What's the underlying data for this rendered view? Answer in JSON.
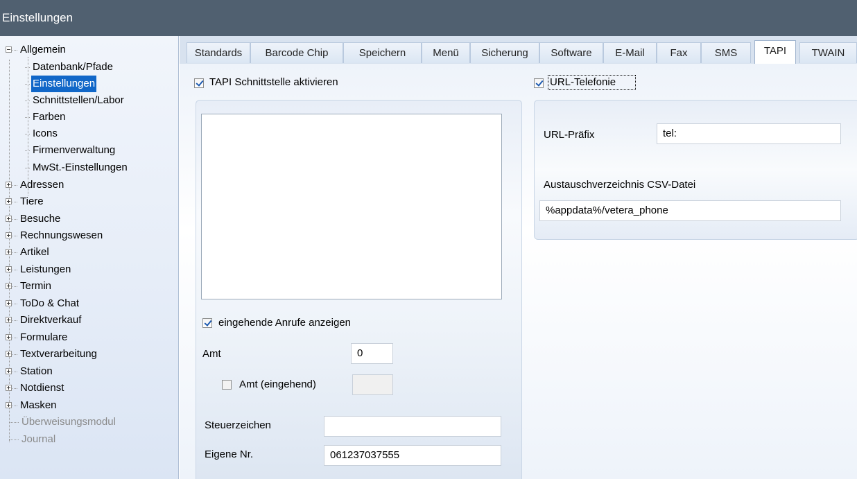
{
  "window": {
    "title": "Einstellungen"
  },
  "tree": {
    "group1_label": "Allgemein",
    "children": [
      "Datenbank/Pfade",
      "Einstellungen",
      "Schnittstellen/Labor",
      "Farben",
      "Icons",
      "Firmenverwaltung",
      "MwSt.-Einstellungen"
    ],
    "groups": [
      "Adressen",
      "Tiere",
      "Besuche",
      "Rechnungswesen",
      "Artikel",
      "Leistungen",
      "Termin",
      "ToDo & Chat",
      "Direktverkauf",
      "Formulare",
      "Textverarbeitung",
      "Station",
      "Notdienst",
      "Masken"
    ],
    "disabled": [
      "Überweisungsmodul",
      "Journal"
    ]
  },
  "tabs": [
    "Standards",
    "Barcode Chip",
    "Speichern",
    "Menü",
    "Sicherung",
    "Software",
    "E-Mail",
    "Fax",
    "SMS",
    "TAPI",
    "TWAIN"
  ],
  "tapi": {
    "enable_label": "TAPI Schnittstelle aktivieren",
    "url_telephony_label": "URL-Telefonie",
    "incoming_label": "eingehende Anrufe anzeigen",
    "amt_label": "Amt",
    "amt_value": "0",
    "amt_incoming_label": "Amt (eingehend)",
    "amt_incoming_value": "",
    "control_label": "Steuerzeichen",
    "control_value": "",
    "own_number_label": "Eigene Nr.",
    "own_number_value": "061237037555",
    "url_prefix_label": "URL-Präfix",
    "url_prefix_value": "tel:",
    "exchange_dir_label": "Austauschverzeichnis CSV-Datei",
    "exchange_dir_value": "%appdata%/vetera_phone"
  }
}
